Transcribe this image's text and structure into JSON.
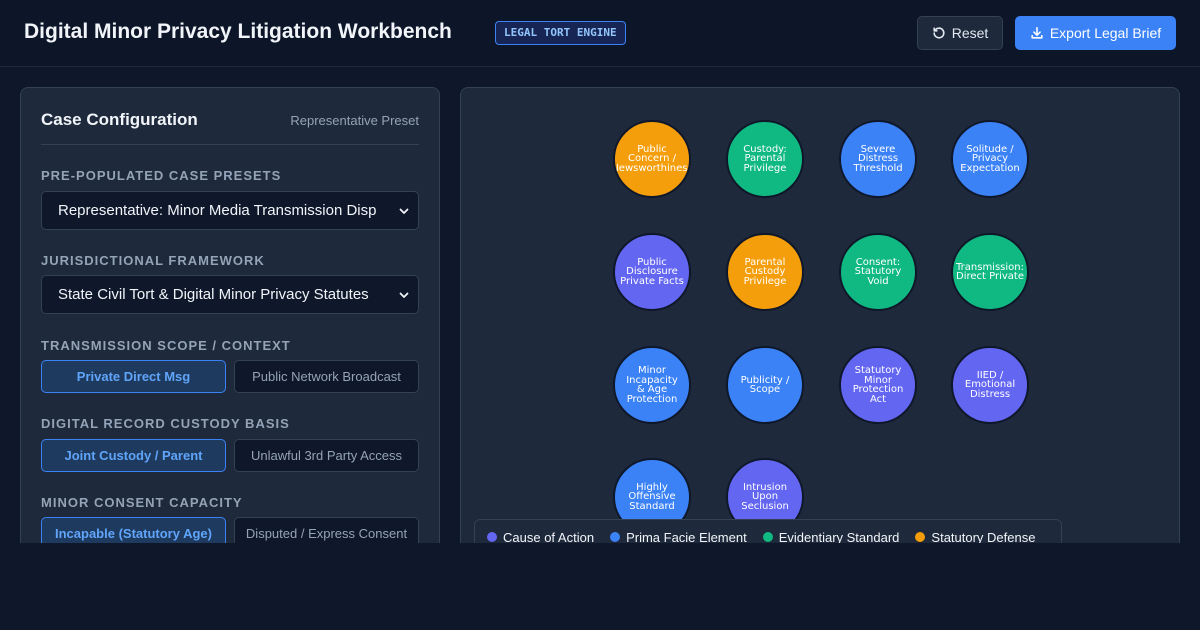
{
  "header": {
    "title": "Digital Minor Privacy Litigation Workbench",
    "badge": "LEGAL TORT ENGINE",
    "reset_label": "Reset",
    "export_label": "Export Legal Brief"
  },
  "config": {
    "title": "Case Configuration",
    "subtitle": "Representative Preset",
    "presets_label": "PRE-POPULATED CASE PRESETS",
    "preset_value": "Representative: Minor Media Transmission Disp",
    "jurisdiction_label": "JURISDICTIONAL FRAMEWORK",
    "jurisdiction_value": "State Civil Tort & Digital Minor Privacy Statutes",
    "scope_label": "TRANSMISSION SCOPE / CONTEXT",
    "scope_options": [
      "Private Direct Msg",
      "Public Network Broadcast"
    ],
    "custody_label": "DIGITAL RECORD CUSTODY BASIS",
    "custody_options": [
      "Joint Custody / Parent",
      "Unlawful 3rd Party Access"
    ],
    "consent_label": "MINOR CONSENT CAPACITY",
    "consent_options": [
      "Incapable (Statutory Age)",
      "Disputed / Express Consent"
    ]
  },
  "colors": {
    "cause": "#6366f1",
    "element": "#3b82f6",
    "evidence": "#10b981",
    "defense": "#f59e0b"
  },
  "nodes": [
    {
      "lines": [
        "Public",
        "Concern /",
        "Newsworthiness"
      ],
      "category": "defense"
    },
    {
      "lines": [
        "Custody:",
        "Parental",
        "Privilege"
      ],
      "category": "evidence"
    },
    {
      "lines": [
        "Severe",
        "Distress",
        "Threshold"
      ],
      "category": "element"
    },
    {
      "lines": [
        "Solitude /",
        "Privacy",
        "Expectation"
      ],
      "category": "element"
    },
    {
      "lines": [
        "Public",
        "Disclosure",
        "Private Facts"
      ],
      "category": "cause"
    },
    {
      "lines": [
        "Parental",
        "Custody",
        "Privilege"
      ],
      "category": "defense"
    },
    {
      "lines": [
        "Consent:",
        "Statutory Void"
      ],
      "category": "evidence"
    },
    {
      "lines": [
        "Transmission:",
        "Direct Private"
      ],
      "category": "evidence"
    },
    {
      "lines": [
        "Minor",
        "Incapacity",
        "& Age",
        "Protection"
      ],
      "category": "element"
    },
    {
      "lines": [
        "Publicity /",
        "Scope"
      ],
      "category": "element"
    },
    {
      "lines": [
        "Statutory",
        "Minor",
        "Protection Act"
      ],
      "category": "cause"
    },
    {
      "lines": [
        "IIED /",
        "Emotional",
        "Distress"
      ],
      "category": "cause"
    },
    {
      "lines": [
        "Highly",
        "Offensive",
        "Standard"
      ],
      "category": "element"
    },
    {
      "lines": [
        "Intrusion",
        "Upon",
        "Seclusion"
      ],
      "category": "cause"
    }
  ],
  "legend": [
    {
      "label": "Cause of Action",
      "category": "cause"
    },
    {
      "label": "Prima Facie Element",
      "category": "element"
    },
    {
      "label": "Evidentiary Standard",
      "category": "evidence"
    },
    {
      "label": "Statutory Defense",
      "category": "defense"
    }
  ]
}
